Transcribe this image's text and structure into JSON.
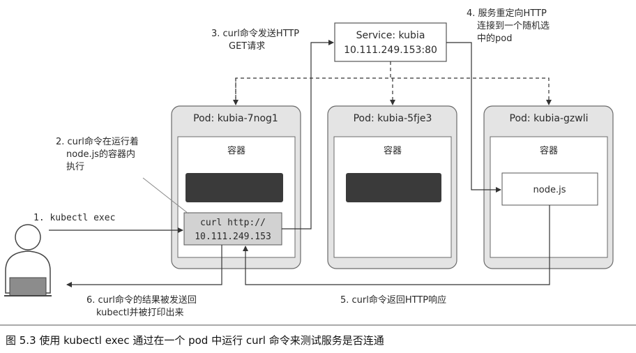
{
  "service": {
    "line1": "Service: kubia",
    "line2": "10.111.249.153:80"
  },
  "pods": [
    {
      "title": "Pod: kubia-7nog1",
      "container_label": "容器"
    },
    {
      "title": "Pod: kubia-5fje3",
      "container_label": "容器"
    },
    {
      "title": "Pod: kubia-gzwli",
      "container_label": "容器"
    }
  ],
  "curl_box": {
    "line1": "curl http://",
    "line2": "10.111.249.153"
  },
  "nodejs_box": {
    "label": "node.js"
  },
  "steps": {
    "step1": "1. kubectl exec",
    "step2": [
      "2. curl命令在运行着",
      "node.js的容器内",
      "执行"
    ],
    "step3": [
      "3. curl命令发送HTTP",
      "GET请求"
    ],
    "step4": [
      "4. 服务重定向HTTP",
      "连接到一个随机选",
      "中的pod"
    ],
    "step5": "5. curl命令返回HTTP响应",
    "step6": [
      "6. curl命令的结果被发送回",
      "kubectl并被打印出来"
    ]
  },
  "caption": "图 5.3   使用 kubectl exec 通过在一个 pod 中运行 curl 命令来测试服务是否连通",
  "colors": {
    "pod_fill": "#e4e4e4",
    "pod_stroke": "#6a6a6a",
    "container_fill": "#ffffff",
    "dark_bar": "#3a3a3a",
    "curl_box_fill": "#d2d2d2",
    "line": "#333333"
  }
}
